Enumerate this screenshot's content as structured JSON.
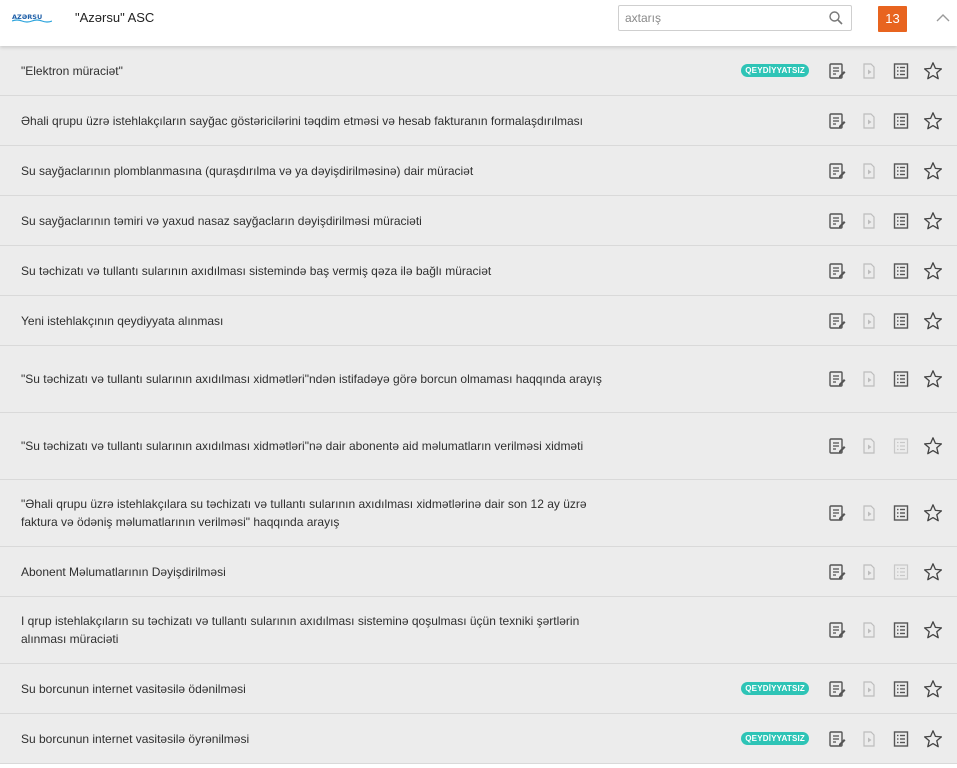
{
  "header": {
    "logo_text": "AZƏRSU",
    "org_title": "\"Azərsu\" ASC",
    "search_placeholder": "axtarış",
    "counter": "13"
  },
  "badge_label": "QEYDİYYATSIZ",
  "colors": {
    "accent": "#e8641f",
    "badge": "#2ec4b6",
    "row_bg": "#ececec"
  },
  "services": [
    {
      "title": "\"Elektron müraciət\"",
      "badge": true,
      "doc_enabled": true
    },
    {
      "title": "Əhali qrupu üzrə istehlakçıların sayğac göstəricilərini təqdim etməsi və hesab fakturanın formalaşdırılması",
      "badge": false,
      "doc_enabled": true
    },
    {
      "title": "Su sayğaclarının plomblanmasına (quraşdırılma və ya dəyişdirilməsinə) dair müraciət",
      "badge": false,
      "doc_enabled": true
    },
    {
      "title": "Su sayğaclarının təmiri və yaxud nasaz sayğacların dəyişdirilməsi müraciəti",
      "badge": false,
      "doc_enabled": true
    },
    {
      "title": "Su təchizatı və tullantı sularının axıdılması sistemində baş vermiş qəza ilə bağlı müraciət",
      "badge": false,
      "doc_enabled": true
    },
    {
      "title": "Yeni istehlakçının qeydiyyata alınması",
      "badge": false,
      "doc_enabled": true
    },
    {
      "title": "\"Su təchizatı və tullantı sularının axıdılması xidmətləri\"ndən istifadəyə görə borcun olmaması haqqında arayış",
      "badge": false,
      "doc_enabled": true
    },
    {
      "title": "\"Su təchizatı və tullantı sularının axıdılması xidmətləri\"nə dair abonentə aid məlumatların verilməsi xidməti",
      "badge": false,
      "doc_enabled": false
    },
    {
      "title": "\"Əhali qrupu üzrə istehlakçılara su təchizatı və tullantı sularının axıdılması xidmətlərinə dair son 12 ay üzrə faktura və ödəniş məlumatlarının verilməsi\" haqqında arayış",
      "badge": false,
      "doc_enabled": true
    },
    {
      "title": "Abonent Məlumatlarının Dəyişdirilməsi",
      "badge": false,
      "doc_enabled": false
    },
    {
      "title": "I qrup istehlakçıların su təchizatı və tullantı sularının axıdılması sisteminə qoşulması üçün texniki şərtlərin alınması müraciəti",
      "badge": false,
      "doc_enabled": true
    },
    {
      "title": "Su borcunun internet vasitəsilə ödənilməsi",
      "badge": true,
      "doc_enabled": true
    },
    {
      "title": "Su borcunun internet vasitəsilə öyrənilməsi",
      "badge": true,
      "doc_enabled": true
    }
  ]
}
